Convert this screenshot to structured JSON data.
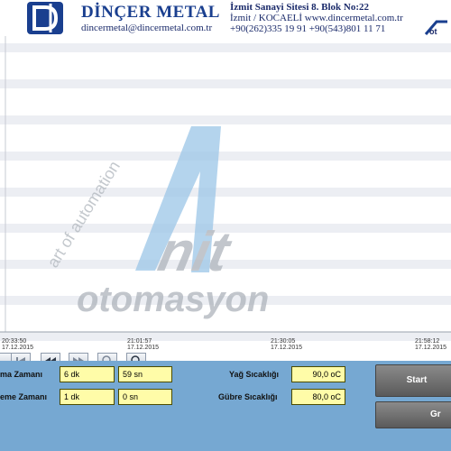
{
  "header": {
    "brand": "DİNÇER METAL",
    "email": "dincermetal@dincermetal.com.tr",
    "address_line1": "İzmit Sanayi Sitesi 8. Blok No:22",
    "address_line2": "İzmit / KOCAELİ     www.dincermetal.com.tr",
    "address_line3": "+90(262)335 19 91   +90(543)801 11 71"
  },
  "chart": {
    "watermark_line1": "art of automation",
    "watermark_line2": "nit",
    "watermark_line3": "otomasyon",
    "ticks": [
      {
        "time": "20:33:50",
        "date": "17.12.2015"
      },
      {
        "time": "21:01:57",
        "date": "17.12.2015"
      },
      {
        "time": "21:30:05",
        "date": "17.12.2015"
      },
      {
        "time": "21:58:12",
        "date": "17.12.2015"
      }
    ]
  },
  "toolbar": {
    "buttons": [
      "first-page-icon",
      "previous-icon",
      "next-icon",
      "zoom-icon",
      "zoom-reset-icon"
    ]
  },
  "controls": {
    "row1_label": "ma Zamanı",
    "row1_min": "6 dk",
    "row1_sec": "59 sn",
    "row2_label": "eme Zamanı",
    "row2_min": "1 dk",
    "row2_sec": "0 sn",
    "oil_temp_label": "Yağ Sıcaklığı",
    "oil_temp_value": "90,0 oC",
    "fert_temp_label": "Gübre Sıcaklığı",
    "fert_temp_value": "80,0 oC",
    "start_label": "Start",
    "graph_label": "Gr"
  }
}
